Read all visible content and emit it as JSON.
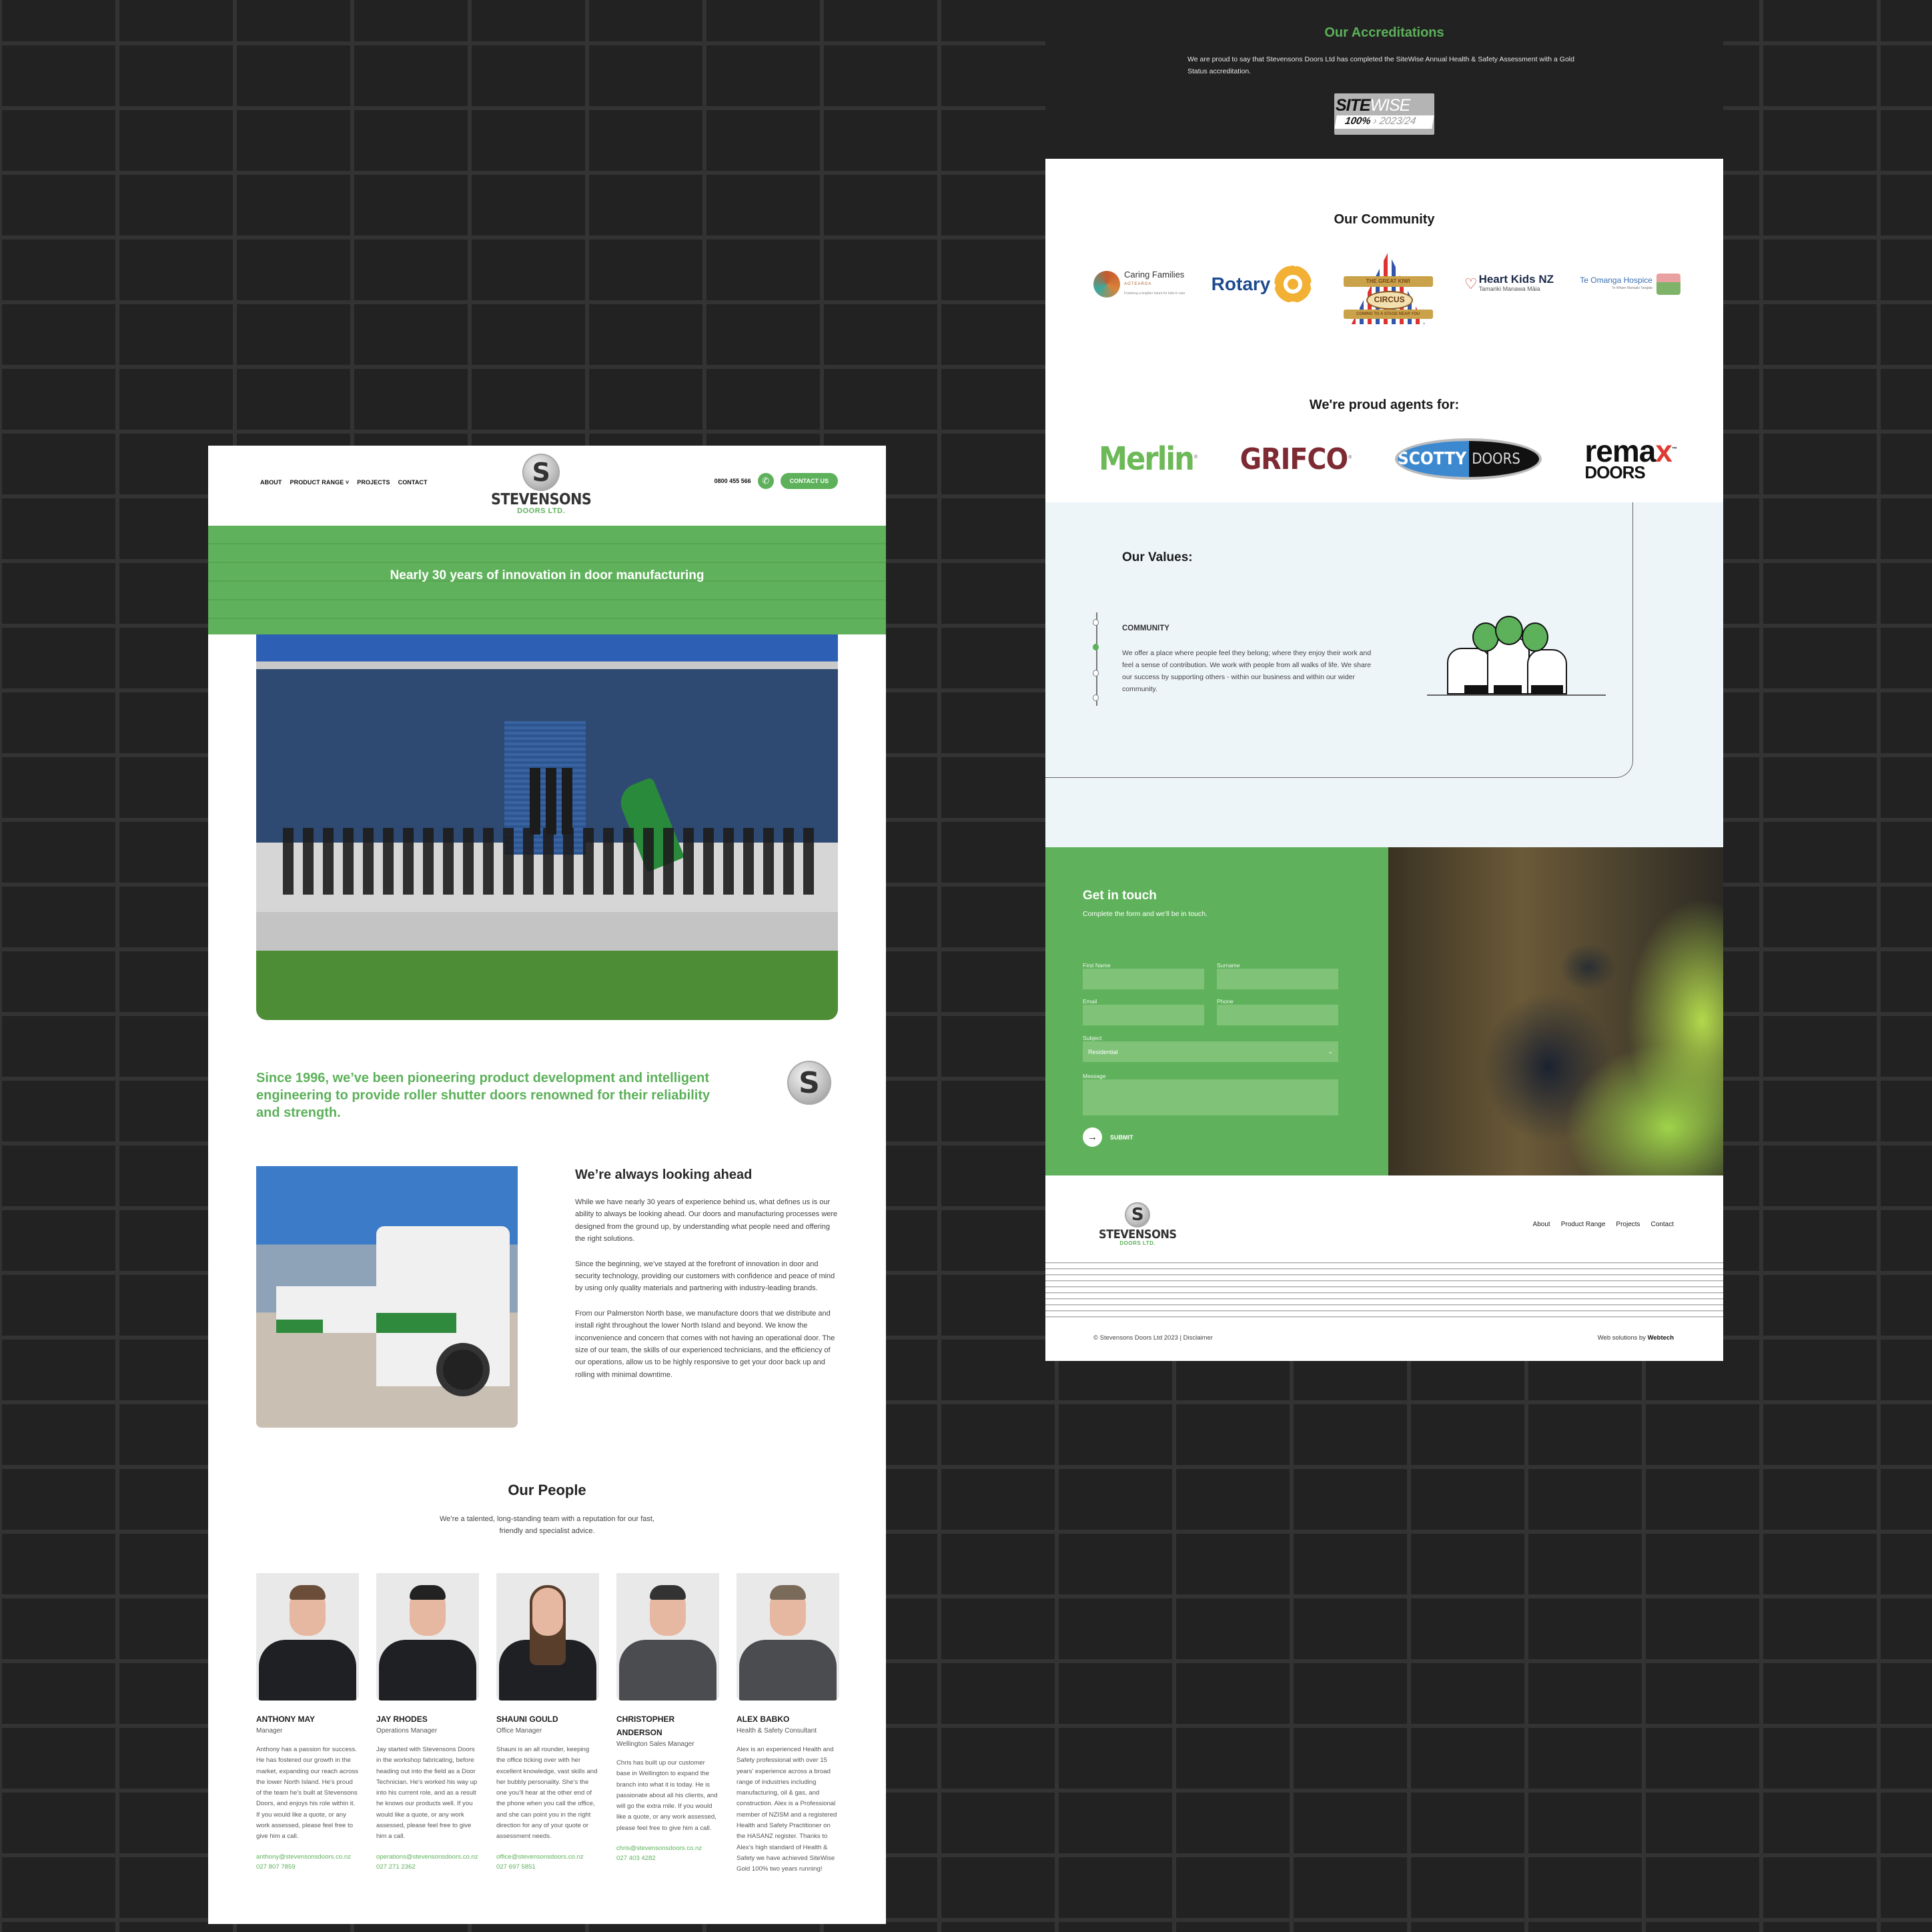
{
  "brand": {
    "name": "STEVENSONS",
    "sub": "DOORS LTD.",
    "accent": "#5cb15a",
    "dark_bg": "#222222"
  },
  "header": {
    "nav": [
      "ABOUT",
      "PRODUCT RANGE",
      "PROJECTS",
      "CONTACT"
    ],
    "dropdown_caret": "˅",
    "phone": "0800 455 566",
    "phone_icon": "phone-icon",
    "contact_button": "CONTACT US"
  },
  "hero": {
    "title": "Nearly 30 years of innovation in door manufacturing"
  },
  "intro": {
    "text": "Since 1996, we’ve been pioneering product development and intelligent engineering to provide roller shutter doors renowned for their reliability and strength."
  },
  "ahead": {
    "title": "We’re always looking ahead",
    "paragraphs": [
      "While we have nearly 30 years of experience behind us, what defines us is our ability to always be looking ahead. Our doors and manufacturing processes were designed from the ground up, by understanding what people need and offering the right solutions.",
      "Since the beginning, we’ve stayed at the forefront of innovation in door and security technology, providing our customers with confidence and peace of mind by using only quality materials and partnering with industry-leading brands.",
      "From our Palmerston North base, we manufacture doors that we distribute and install right throughout the lower North Island and beyond. We know the inconvenience and concern that comes with not having an operational door. The size of our team, the skills of our experienced technicians, and the efficiency of our operations, allow us to be highly responsive to get your door back up and rolling with minimal downtime."
    ]
  },
  "people": {
    "title": "Our People",
    "subtitle": "We’re a talented, long-standing team with a reputation for our fast, friendly and specialist advice.",
    "members": [
      {
        "name": "ANTHONY MAY",
        "role": "Manager",
        "bio": "Anthony has a passion for success. He has fostered our growth in the market, expanding our reach across the lower North Island. He’s proud of the team he’s built at Stevensons Doors, and enjoys his role within it. If you would like a quote, or any work assessed, please feel free to give him a call.",
        "email": "anthony@stevensonsdoors.co.nz",
        "phone": "027 807 7859"
      },
      {
        "name": "JAY RHODES",
        "role": "Operations Manager",
        "bio": "Jay started with Stevensons Doors in the workshop fabricating, before heading out into the field as a Door Technician. He’s worked his way up into his current role, and as a result he knows our products well. If you would like a quote, or any work assessed, please feel free to give him a call.",
        "email": "operations@stevensonsdoors.co.nz",
        "phone": "027 271 2362"
      },
      {
        "name": "SHAUNI GOULD",
        "role": "Office Manager",
        "bio": "Shauni is an all rounder, keeping the office ticking over with her excellent knowledge, vast skills and her bubbly personality. She’s the one you’ll hear at the other end of the phone when you call the office, and she can point you in the right direction for any of your quote or assessment needs.",
        "email": "office@stevensonsdoors.co.nz",
        "phone": "027 697 5851"
      },
      {
        "name": "CHRISTOPHER ANDERSON",
        "role": "Wellington Sales Manager",
        "bio": "Chris has built up our customer base in Wellington to expand the branch into what it is today. He is passionate about all his clients, and will go the extra mile. If you would like a quote, or any work assessed, please feel free to give him a call.",
        "email": "chris@stevensonsdoors.co.nz",
        "phone": "027 403 4282"
      },
      {
        "name": "ALEX BABKO",
        "role": "Health & Safety Consultant",
        "bio": "Alex is an experienced Health and Safety professional with over 15 years’ experience across a broad range of industries including manufacturing, oil & gas, and construction. Alex is a Professional member of NZISM and a registered Health and Safety Practitioner on the HASANZ register. Thanks to Alex’s high standard of Health & Safety we have achieved SiteWise Gold 100% two years running!",
        "email": "",
        "phone": ""
      }
    ]
  },
  "accreditations": {
    "title": "Our Accreditations",
    "text": "We are proud to say that Stevensons Doors Ltd has completed the SiteWise Annual Health & Safety Assessment with a Gold Status accreditation.",
    "badge": {
      "word1": "SITE",
      "word2": "WISE",
      "score": "100%",
      "year": "2023/24"
    }
  },
  "community": {
    "title": "Our Community",
    "logos": {
      "caring_families": {
        "name": "Caring Families",
        "sub": "AOTEAROA",
        "tagline": "Fostering a brighter future for kids in care"
      },
      "rotary": {
        "name": "Rotary"
      },
      "circus": {
        "banner": "THE GREAT KIWI",
        "name": "CIRCUS",
        "tagline": "COMING TO A STAGE NEAR YOU"
      },
      "heart_kids": {
        "name": "Heart Kids NZ",
        "sub": "Tamariki Manawa Māia"
      },
      "te_omanga": {
        "name": "Te Omanga Hospice",
        "sub": "Te Whare Manaaki Tangata"
      }
    }
  },
  "agents": {
    "title": "We're proud agents for:",
    "logos": {
      "merlin": "Merlin",
      "grifco": "GRIFCO",
      "scotty_1": "SCOTTY",
      "scotty_2": "DOORS",
      "remax_1": "rema",
      "remax_x": "x",
      "remax_2": "DOORS",
      "tm": "™",
      "reg": "®"
    }
  },
  "values": {
    "title": "Our Values:",
    "active_index": 1,
    "steps": 4,
    "item_title": "COMMUNITY",
    "item_text": "We offer a place where people feel they belong; where they enjoy their work and feel a sense of contribution. We work with people from all walks of life. We share our success by supporting others - within our business and within our wider community."
  },
  "contact": {
    "title": "Get in touch",
    "subtitle": "Complete the form and we'll be in touch.",
    "fields": {
      "first_name": "First Name",
      "surname": "Surname",
      "email": "Email",
      "phone": "Phone",
      "subject": "Subject",
      "subject_value": "Residential",
      "message": "Message"
    },
    "submit": "SUBMIT"
  },
  "footer": {
    "nav": [
      "About",
      "Product Range",
      "Projects",
      "Contact"
    ],
    "copyright": "© Stevensons Doors Ltd 2023 | Disclaimer",
    "credit_prefix": "Web solutions by ",
    "credit_brand": "Webtech"
  }
}
